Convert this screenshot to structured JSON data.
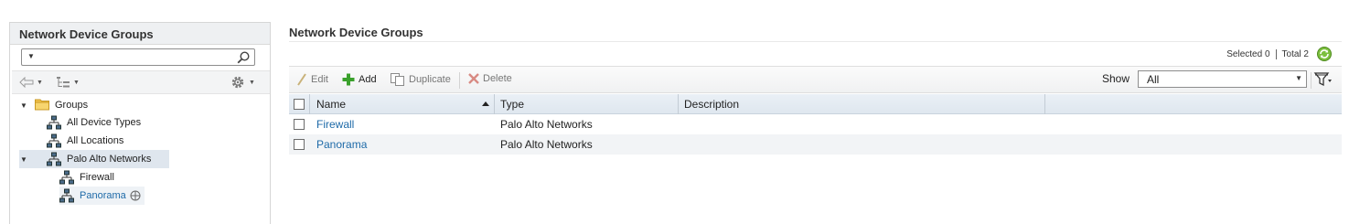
{
  "left": {
    "title": "Network Device Groups",
    "tree": [
      {
        "label": "Groups",
        "expanded": true,
        "icon": "folder-icon"
      },
      {
        "label": "All Device Types",
        "icon": "network-hierarchy-icon"
      },
      {
        "label": "All Locations",
        "icon": "network-hierarchy-icon"
      },
      {
        "label": "Palo Alto Networks",
        "expanded": true,
        "icon": "network-hierarchy-icon",
        "selected": true
      },
      {
        "label": "Firewall",
        "icon": "network-hierarchy-icon"
      },
      {
        "label": "Panorama",
        "icon": "network-hierarchy-icon",
        "highlighted": true
      }
    ]
  },
  "main": {
    "title": "Network Device Groups",
    "selected_label": "Selected 0",
    "total_label": "Total 2",
    "toolbar": {
      "edit": "Edit",
      "add": "Add",
      "duplicate": "Duplicate",
      "delete": "Delete",
      "show_label": "Show",
      "show_value": "All"
    },
    "columns": [
      "Name",
      "Type",
      "Description"
    ],
    "rows": [
      {
        "name": "Firewall",
        "type": "Palo Alto Networks",
        "description": ""
      },
      {
        "name": "Panorama",
        "type": "Palo Alto Networks",
        "description": ""
      }
    ]
  },
  "colors": {
    "link": "#1e6aa8",
    "selected_row": "#dfe6ee",
    "header_bg": "#e4ebf2",
    "add_green": "#3aa12c",
    "delete_red": "#c0392b"
  }
}
